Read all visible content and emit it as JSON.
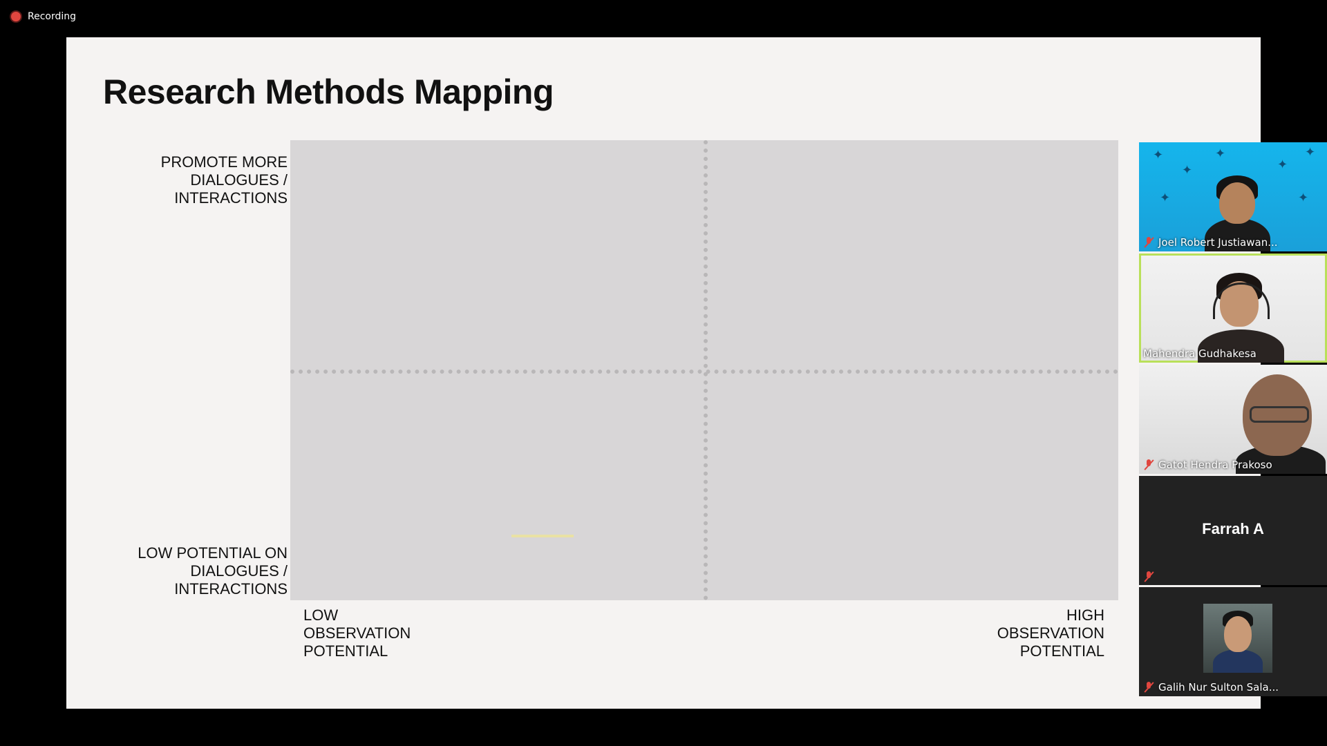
{
  "recording": {
    "label": "Recording"
  },
  "slide": {
    "title": "Research Methods Mapping",
    "y_axis": {
      "top_label": "PROMOTE MORE DIALOGUES / INTERACTIONS",
      "bottom_label": "LOW POTENTIAL ON DIALOGUES / INTERACTIONS"
    },
    "x_axis": {
      "left_label": "LOW OBSERVATION POTENTIAL",
      "right_label": "HIGH OBSERVATION POTENTIAL"
    }
  },
  "participants": [
    {
      "name": "Joel Robert Justiawan...",
      "muted": true,
      "video": true
    },
    {
      "name": "Mahendra Gudhakesa",
      "muted": false,
      "video": true,
      "active_speaker": true
    },
    {
      "name": "Gatot Hendra Prakoso",
      "muted": true,
      "video": true
    },
    {
      "name": "Farrah A",
      "muted": true,
      "video": false
    },
    {
      "name": "Galih Nur Sulton Sala...",
      "muted": true,
      "video": true
    }
  ],
  "colors": {
    "recording_red": "#e0463f",
    "active_speaker_outline": "#b9e05a",
    "slide_background": "#f5f3f2",
    "quadrant_fill": "#d8d6d7"
  }
}
